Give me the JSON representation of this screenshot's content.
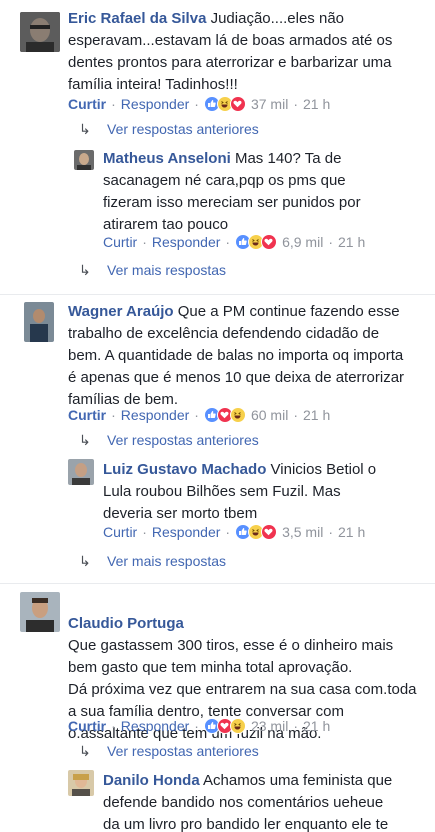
{
  "labels": {
    "like": "Curtir",
    "reply": "Responder",
    "dot": "·",
    "view_previous": "Ver respostas anteriores",
    "view_more": "Ver mais respostas"
  },
  "comments": [
    {
      "author": "Eric Rafael da Silva",
      "text": "Judiação....eles não esperavam...estavam lá de boas armados até os dentes prontos para aterrorizar e barbarizar uma família inteira! Tadinhos!!!",
      "reactions": [
        "like",
        "haha",
        "love"
      ],
      "count": "37 mil",
      "time": "21 h",
      "reply": {
        "author": "Matheus Anseloni",
        "text": "Mas 140? Ta de sacanagem né cara,pqp os pms que fizeram isso mereciam ser punidos por atirarem tao pouco",
        "reactions": [
          "like",
          "haha",
          "love"
        ],
        "count": "6,9 mil",
        "time": "21 h"
      }
    },
    {
      "author": "Wagner Araújo",
      "text": "Que a PM continue fazendo esse trabalho de excelência defendendo cidadão de bem. A quantidade de balas no importa oq importa é apenas que é menos 10 que deixa de aterrorizar famílias de bem.",
      "reactions": [
        "like",
        "love",
        "haha"
      ],
      "count": "60 mil",
      "time": "21 h",
      "reply": {
        "author": "Luiz Gustavo Machado",
        "text": "Vinicios Betiol o Lula roubou Bilhões sem Fuzil. Mas deveria ser morto tbem",
        "reactions": [
          "like",
          "haha",
          "love"
        ],
        "count": "3,5 mil",
        "time": "21 h"
      }
    },
    {
      "author": "Claudio Portuga",
      "text": "Que gastassem 300 tiros, esse é o dinheiro mais bem gasto que tem minha total aprovação.\nDá próxima vez que entrarem na sua casa com.toda a sua família dentro, tente conversar com o.assaltante que tem um fuzil na mão.",
      "reactions": [
        "like",
        "love",
        "haha"
      ],
      "count": "23 mil",
      "time": "21 h",
      "reply": {
        "author": "Danilo Honda",
        "text": "Achamos uma feminista que defende bandido nos comentários ueheue da um livro pro bandido ler enquanto ele te"
      }
    }
  ],
  "colors": {
    "link": "#365899",
    "action": "#4267b2",
    "meta": "#90949c",
    "like": "#5890ff",
    "haha": "#f7d04b",
    "love": "#f0334f"
  }
}
